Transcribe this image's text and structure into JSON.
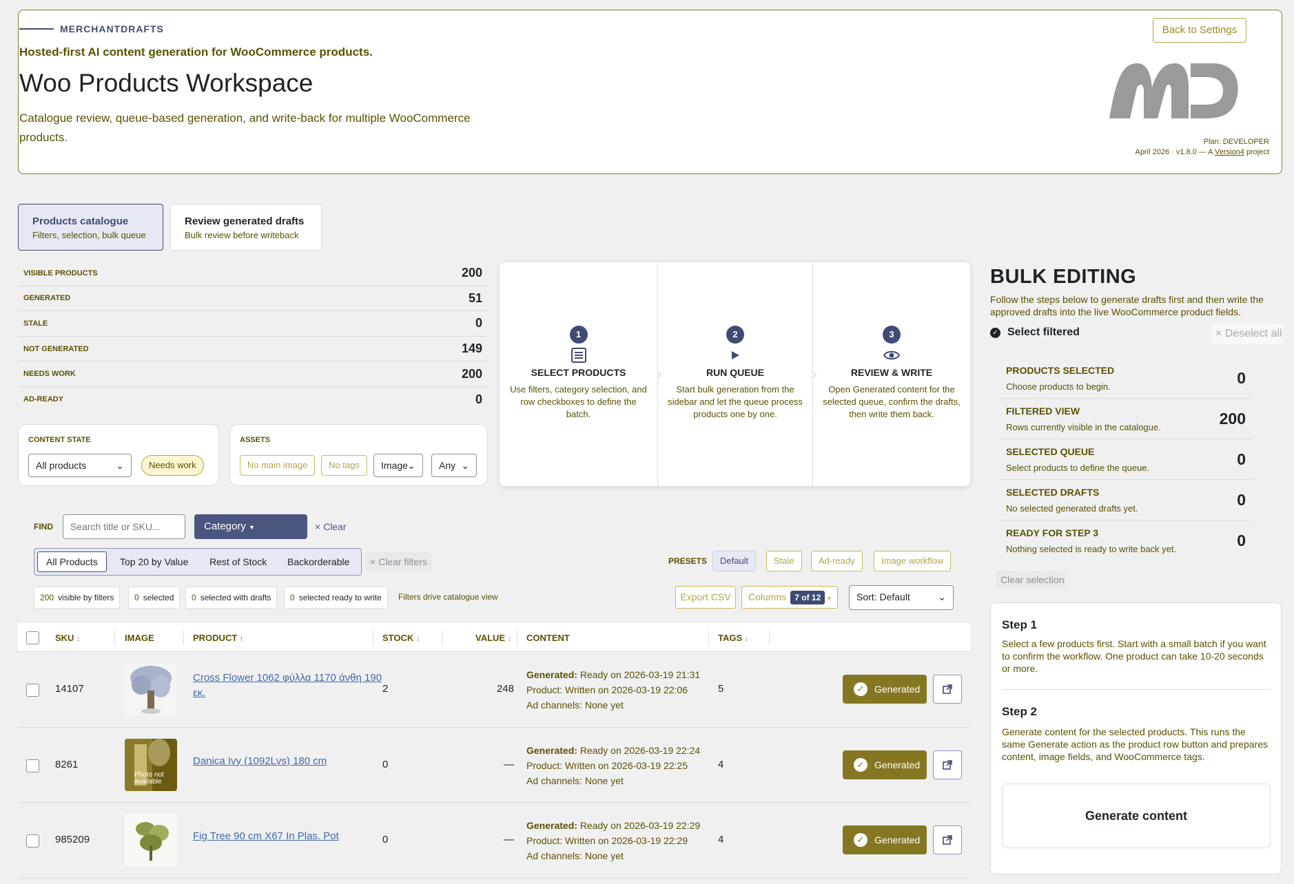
{
  "header": {
    "brand": "MERCHANTDRAFTS",
    "tagline": "Hosted-first AI content generation for WooCommerce products.",
    "title": "Woo Products Workspace",
    "subtitle": "Catalogue review, queue-based generation, and write-back for multiple WooCommerce products.",
    "back_button": "Back to Settings",
    "plan": "Plan: DEVELOPER",
    "version_prefix": "April 2026 · v1.8.0 — A ",
    "version_link": "Version4",
    "version_suffix": " project"
  },
  "tabs": [
    {
      "label": "Products catalogue",
      "sub": "Filters, selection, bulk queue"
    },
    {
      "label": "Review generated drafts",
      "sub": "Bulk review before writeback"
    }
  ],
  "stats": [
    {
      "label": "VISIBLE PRODUCTS",
      "value": "200"
    },
    {
      "label": "GENERATED",
      "value": "51"
    },
    {
      "label": "STALE",
      "value": "0"
    },
    {
      "label": "NOT GENERATED",
      "value": "149"
    },
    {
      "label": "NEEDS WORK",
      "value": "200"
    },
    {
      "label": "AD-READY",
      "value": "0"
    }
  ],
  "content_state": {
    "title": "CONTENT STATE",
    "select_value": "All products",
    "pill": "Needs work"
  },
  "assets": {
    "title": "ASSETS",
    "pill1": "No main image",
    "pill2": "No tags",
    "select1": "Image",
    "select2": "Any"
  },
  "steps": [
    {
      "num": "1",
      "title": "SELECT PRODUCTS",
      "desc": "Use filters, category selection, and row checkboxes to define the batch.",
      "icon": "list-icon"
    },
    {
      "num": "2",
      "title": "RUN QUEUE",
      "desc": "Start bulk generation from the sidebar and let the queue process products one by one.",
      "icon": "play-icon"
    },
    {
      "num": "3",
      "title": "REVIEW & WRITE",
      "desc": "Open Generated content for the selected queue, confirm the drafts, then write them back.",
      "icon": "eye-icon"
    }
  ],
  "find": {
    "label": "FIND",
    "placeholder": "Search title or SKU...",
    "category": "Category",
    "clear": "Clear"
  },
  "segments": [
    "All Products",
    "Top 20 by Value",
    "Rest of Stock",
    "Backorderable"
  ],
  "clear_filters": "Clear filters",
  "presets": {
    "label": "PRESETS",
    "items": [
      "Default",
      "Stale",
      "Ad-ready",
      "Image workflow"
    ]
  },
  "counts": [
    {
      "n": "200",
      "label": "visible by filters"
    },
    {
      "n": "0",
      "label": "selected"
    },
    {
      "n": "0",
      "label": "selected with drafts"
    },
    {
      "n": "0",
      "label": "selected ready to write"
    }
  ],
  "filters_note": "Filters drive catalogue view",
  "export_csv": "Export CSV",
  "columns": {
    "label": "Columns",
    "badge": "7 of 12"
  },
  "sort": "Sort: Default",
  "table": {
    "headers": {
      "sku": "SKU",
      "image": "IMAGE",
      "product": "PRODUCT",
      "stock": "STOCK",
      "value": "VALUE",
      "content": "CONTENT",
      "tags": "TAGS"
    },
    "rows": [
      {
        "sku": "14107",
        "product": "Cross Flower 1062 φύλλα 1170 άνθη 190 εκ.",
        "stock": "2",
        "value": "248",
        "generated": "Ready on 2026-03-19 21:31",
        "product_status": "Written on 2026-03-19 22:06",
        "ad": "None yet",
        "tags": "5",
        "button": "Generated"
      },
      {
        "sku": "8261",
        "product": "Danica Ivy (1092Lvs) 180 cm",
        "stock": "0",
        "value": "—",
        "generated": "Ready on 2026-03-19 22:24",
        "product_status": "Written on 2026-03-19 22:25",
        "ad": "None yet",
        "tags": "4",
        "button": "Generated",
        "thumb_text": "Photo not available"
      },
      {
        "sku": "985209",
        "product": "Fig Tree 90 cm X67 In Plas. Pot",
        "stock": "0",
        "value": "—",
        "generated": "Ready on 2026-03-19 22:29",
        "product_status": "Written on 2026-03-19 22:29",
        "ad": "None yet",
        "tags": "4",
        "button": "Generated"
      }
    ],
    "labels": {
      "generated": "Generated:",
      "product": "Product:",
      "ad": "Ad channels:"
    }
  },
  "sidebar": {
    "title": "BULK EDITING",
    "desc": "Follow the steps below to generate drafts first and then write the approved drafts into the live WooCommerce product fields.",
    "select_filtered": "Select filtered",
    "deselect_all": "Deselect all",
    "stats": [
      {
        "label": "PRODUCTS SELECTED",
        "sub": "Choose products to begin.",
        "value": "0"
      },
      {
        "label": "FILTERED VIEW",
        "sub": "Rows currently visible in the catalogue.",
        "value": "200"
      },
      {
        "label": "SELECTED QUEUE",
        "sub": "Select products to define the queue.",
        "value": "0"
      },
      {
        "label": "SELECTED DRAFTS",
        "sub": "No selected generated drafts yet.",
        "value": "0"
      },
      {
        "label": "READY FOR STEP 3",
        "sub": "Nothing selected is ready to write back yet.",
        "value": "0"
      }
    ],
    "clear_selection": "Clear selection",
    "step1_title": "Step 1",
    "step1_text": "Select a few products first. Start with a small batch if you want to confirm the workflow. One product can take 10-20 seconds or more.",
    "step2_title": "Step 2",
    "step2_text": "Generate content for the selected products. This runs the same Generate action as the product row button and prepares content, image fields, and WooCommerce tags.",
    "generate_button": "Generate content"
  },
  "colors": {
    "accent": "#3f4b72",
    "olive": "#857622",
    "olive_text": "#5c5000"
  }
}
